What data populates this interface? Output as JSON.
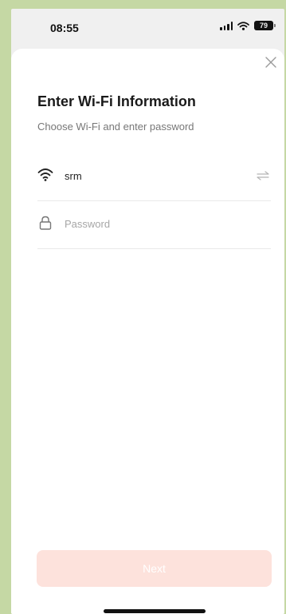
{
  "status_bar": {
    "time": "08:55",
    "battery": "79",
    "icons": [
      "signal-icon",
      "wifi-icon",
      "battery-icon"
    ]
  },
  "dialog": {
    "close_icon": "close-icon",
    "title": "Enter Wi-Fi Information",
    "subtitle": "Choose Wi-Fi and enter password",
    "wifi": {
      "icon": "wifi-icon",
      "ssid": "srm",
      "switch_icon": "swap-network-icon"
    },
    "password": {
      "icon": "lock-icon",
      "placeholder": "Password",
      "value": ""
    },
    "next_label": "Next"
  },
  "colors": {
    "background": "#c5d8a4",
    "sheet": "#ffffff",
    "next_button_disabled": "#fde2dc",
    "divider": "#e9e9e9"
  }
}
